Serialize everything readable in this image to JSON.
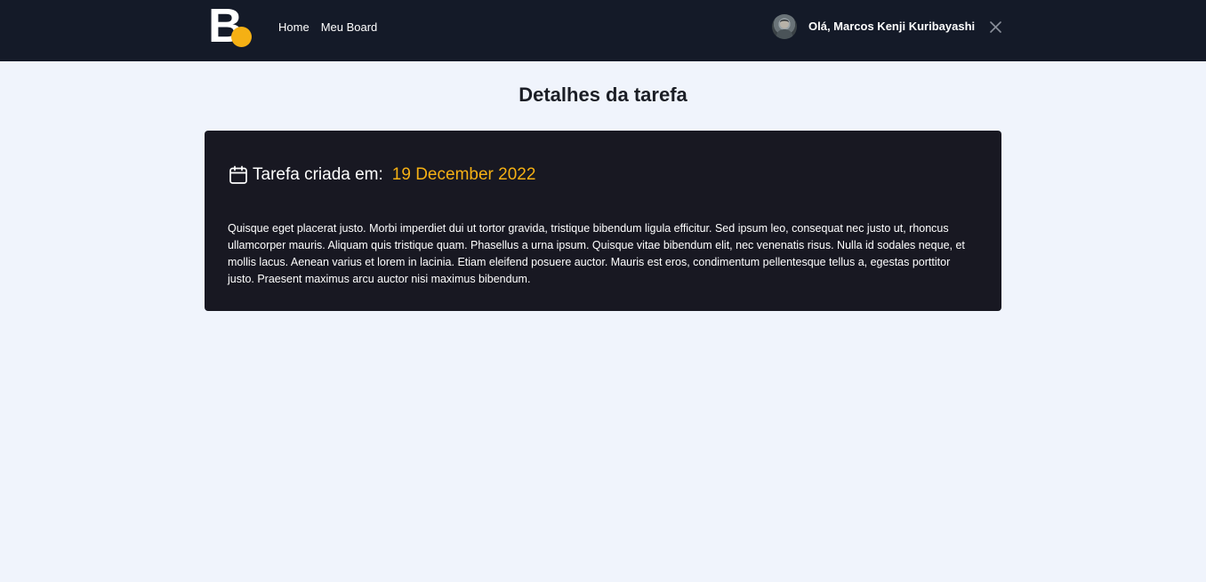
{
  "header": {
    "logo_letter": "B",
    "nav": [
      {
        "label": "Home"
      },
      {
        "label": "Meu Board"
      }
    ],
    "user": {
      "greeting": "Olá, Marcos Kenji Kuribayashi",
      "avatar_icon": "user-avatar"
    },
    "close_icon": "close-icon"
  },
  "main": {
    "title": "Detalhes da tarefa",
    "task": {
      "created_label": "Tarefa criada em:",
      "created_date": "19 December 2022",
      "description": "Quisque eget placerat justo. Morbi imperdiet dui ut tortor gravida, tristique bibendum ligula efficitur. Sed ipsum leo, consequat nec justo ut, rhoncus ullamcorper mauris. Aliquam quis tristique quam. Phasellus a urna ipsum. Quisque vitae bibendum elit, nec venenatis risus. Nulla id sodales neque, et mollis lacus. Aenean varius et lorem in lacinia. Etiam eleifend posuere auctor. Mauris est eros, condimentum pellentesque tellus a, egestas porttitor justo. Praesent maximus arcu auctor nisi maximus bibendum."
    }
  },
  "colors": {
    "header_bg": "#141a28",
    "page_bg": "#f0f4fc",
    "card_bg": "#181822",
    "accent": "#f5b014"
  }
}
